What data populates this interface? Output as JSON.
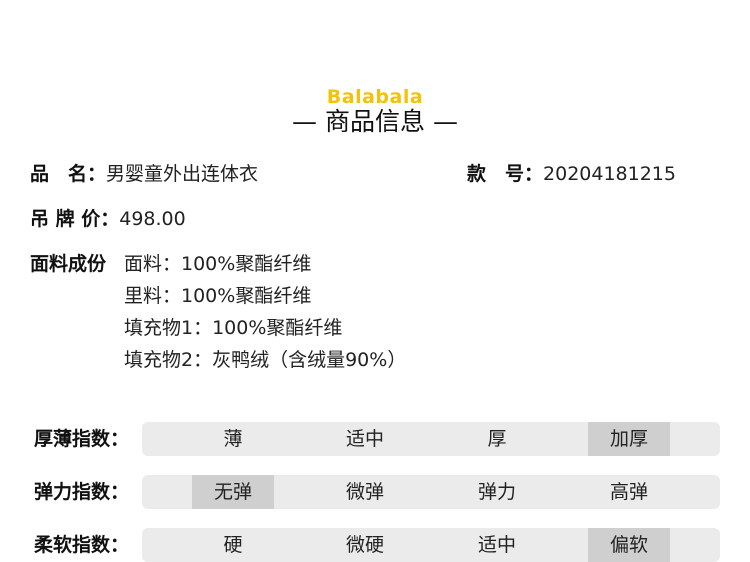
{
  "header": {
    "brand": "Balabala",
    "title": "— 商品信息 —"
  },
  "info": {
    "name": {
      "label": "品　名：",
      "value": "男婴童外出连体衣"
    },
    "style": {
      "label": "款　号：",
      "value": "20204181215"
    },
    "price": {
      "label": "吊 牌 价：",
      "value": "498.00"
    },
    "composition": {
      "label": "面料成份",
      "lines": [
        "面料：100%聚酯纤维",
        "里料：100%聚酯纤维",
        "填充物1：100%聚酯纤维",
        "填充物2：灰鸭绒（含绒量90%）"
      ]
    }
  },
  "scales": [
    {
      "label": "厚薄指数：",
      "options": [
        "薄",
        "适中",
        "厚",
        "加厚"
      ],
      "selected_index": 3
    },
    {
      "label": "弹力指数：",
      "options": [
        "无弹",
        "微弹",
        "弹力",
        "高弹"
      ],
      "selected_index": 0
    },
    {
      "label": "柔软指数：",
      "options": [
        "硬",
        "微硬",
        "适中",
        "偏软"
      ],
      "selected_index": 3
    }
  ],
  "colors": {
    "brand": "#f3c20a",
    "bar_bg": "#ebebeb",
    "selected_bg": "#cfcfcf"
  }
}
